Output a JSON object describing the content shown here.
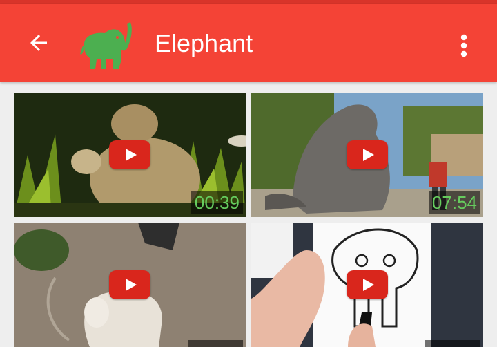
{
  "app_bar": {
    "title": "Elephant",
    "back_icon": "arrow-back-icon",
    "logo_icon": "elephant-icon",
    "menu_icon": "more-vert-icon",
    "color": "#f44336",
    "logo_color": "#4caf50"
  },
  "videos": [
    {
      "duration": "00:39"
    },
    {
      "duration": "07:54"
    },
    {
      "duration": ""
    },
    {
      "duration": ""
    }
  ],
  "colors": {
    "play_button": "#d9261c",
    "duration_text": "#66cc5e"
  }
}
